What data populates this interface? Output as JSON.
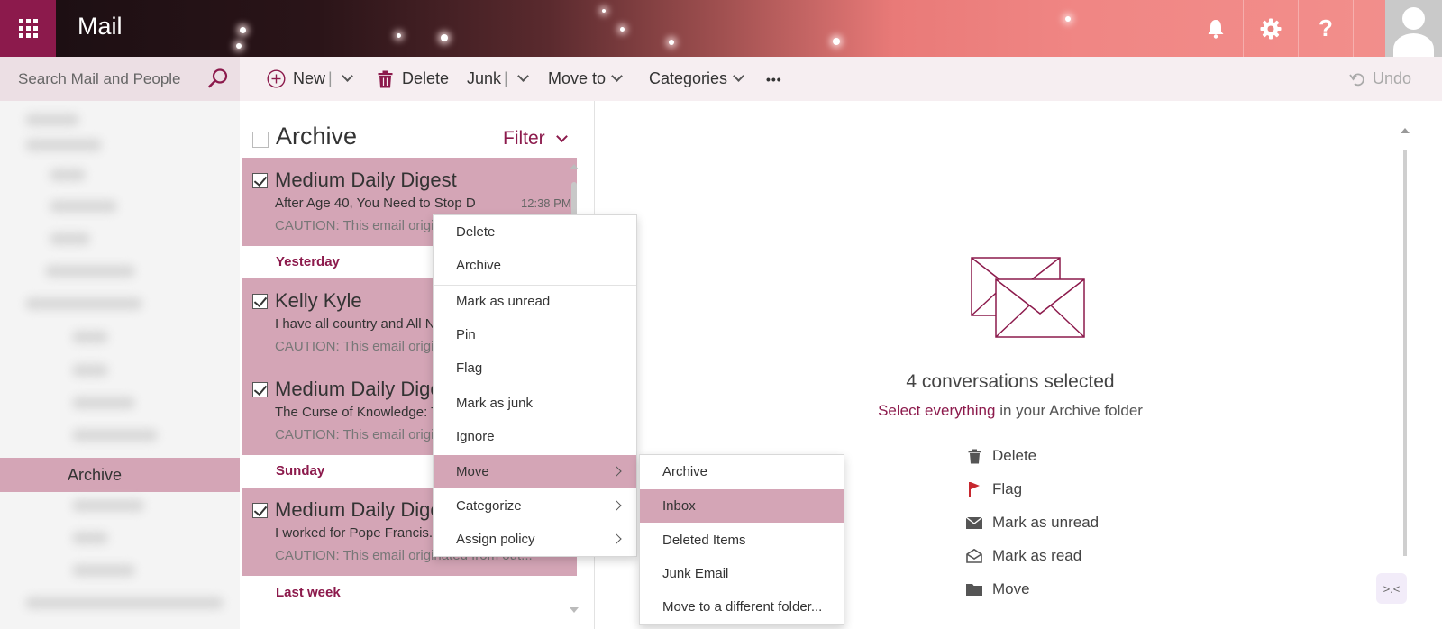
{
  "header": {
    "app_title": "Mail",
    "help_label": "?"
  },
  "search": {
    "placeholder": "Search Mail and People"
  },
  "toolbar": {
    "new_label": "New",
    "delete_label": "Delete",
    "junk_label": "Junk",
    "move_to_label": "Move to",
    "categories_label": "Categories",
    "more_label": "•••",
    "undo_label": "Undo"
  },
  "folders": {
    "selected": "Archive"
  },
  "list": {
    "title": "Archive",
    "filter_label": "Filter",
    "messages": [
      {
        "sender": "Medium Daily Digest",
        "subject": "After Age 40, You Need to Stop D",
        "time": "12:38 PM",
        "preview": "CAUTION: This email origin"
      },
      {
        "sender": "Kelly Kyle",
        "subject": "I have all country and All N",
        "time": "",
        "preview": "CAUTION: This email origin"
      },
      {
        "sender": "Medium Daily Dige",
        "subject": "The Curse of Knowledge: T",
        "time": "",
        "preview": "CAUTION: This email origin"
      },
      {
        "sender": "Medium Daily Dige",
        "subject": "I worked for Pope Francis.",
        "time": "",
        "preview": "CAUTION: This email originated from out..."
      }
    ],
    "groups": [
      "Yesterday",
      "Sunday",
      "Last week"
    ]
  },
  "reading_pane": {
    "selected_count": "4 conversations selected",
    "select_link": "Select everything",
    "select_suffix": " in your Archive folder",
    "actions": [
      "Delete",
      "Flag",
      "Mark as unread",
      "Mark as read",
      "Move"
    ],
    "corner_icon_glyph": ">.<"
  },
  "context_menu": {
    "items": [
      "Delete",
      "Archive",
      "Mark as unread",
      "Pin",
      "Flag",
      "Mark as junk",
      "Ignore",
      "Move",
      "Categorize",
      "Assign policy"
    ],
    "highlighted": "Move"
  },
  "submenu": {
    "items": [
      "Archive",
      "Inbox",
      "Deleted Items",
      "Junk Email",
      "Move to a different folder..."
    ],
    "highlighted": "Inbox"
  },
  "colors": {
    "accent": "#8c1a4c",
    "selection": "#d4a5b6",
    "commandbar": "#f6eef1"
  }
}
